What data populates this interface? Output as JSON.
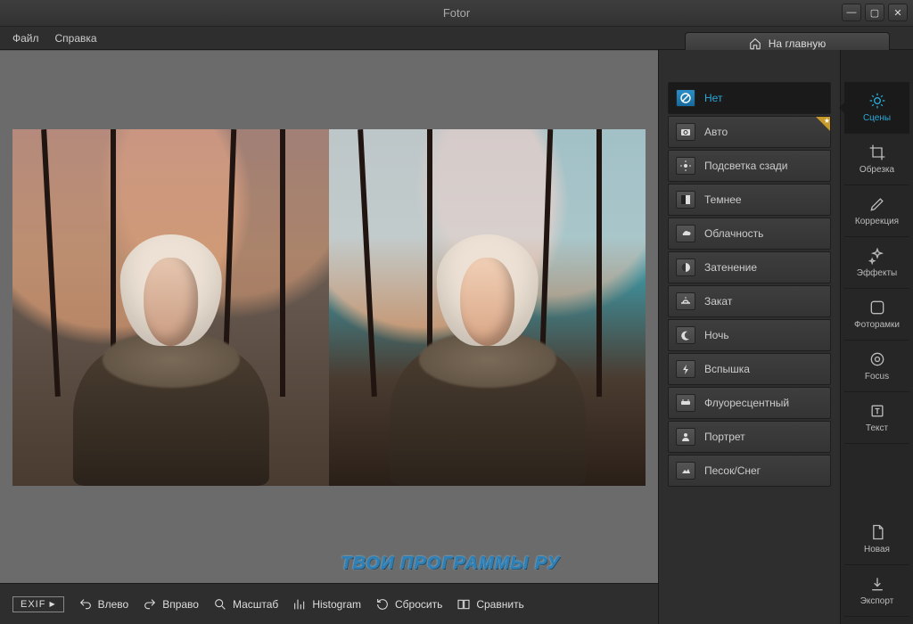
{
  "app": {
    "title": "Fotor"
  },
  "menu": {
    "file": "Файл",
    "help": "Справка",
    "home": "На главную"
  },
  "bottom": {
    "exif": "EXIF",
    "rotate_left": "Влево",
    "rotate_right": "Вправо",
    "zoom": "Масштаб",
    "histogram": "Histogram",
    "reset": "Сбросить",
    "compare": "Сравнить"
  },
  "presets": [
    {
      "label": "Нет",
      "icon": "none"
    },
    {
      "label": "Авто",
      "icon": "camera"
    },
    {
      "label": "Подсветка сзади",
      "icon": "backlight"
    },
    {
      "label": "Темнее",
      "icon": "darken"
    },
    {
      "label": "Облачность",
      "icon": "cloud"
    },
    {
      "label": "Затенение",
      "icon": "shade"
    },
    {
      "label": "Закат",
      "icon": "sunset"
    },
    {
      "label": "Ночь",
      "icon": "night"
    },
    {
      "label": "Вспышка",
      "icon": "flash"
    },
    {
      "label": "Флуоресцентный",
      "icon": "fluorescent"
    },
    {
      "label": "Портрет",
      "icon": "portrait"
    },
    {
      "label": "Песок/Снег",
      "icon": "sand"
    }
  ],
  "tools": [
    {
      "label": "Сцены",
      "icon": "sun"
    },
    {
      "label": "Обрезка",
      "icon": "crop"
    },
    {
      "label": "Коррекция",
      "icon": "pencil"
    },
    {
      "label": "Эффекты",
      "icon": "sparkle"
    },
    {
      "label": "Фоторамки",
      "icon": "frame"
    },
    {
      "label": "Focus",
      "icon": "target"
    },
    {
      "label": "Текст",
      "icon": "text"
    }
  ],
  "tools_footer": [
    {
      "label": "Новая",
      "icon": "page"
    },
    {
      "label": "Экспорт",
      "icon": "export"
    }
  ],
  "watermark": "ТВОИ ПРОГРАММЫ РУ"
}
